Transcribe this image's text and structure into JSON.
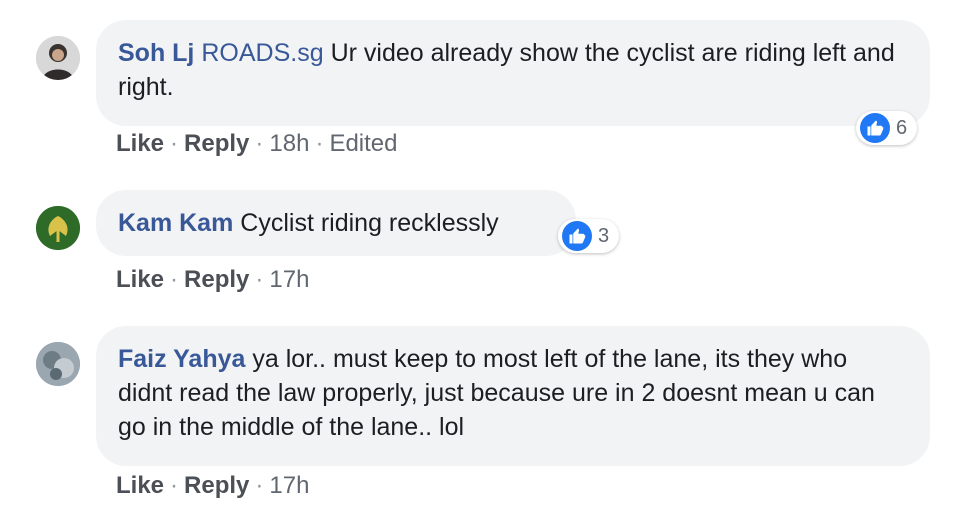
{
  "comments": [
    {
      "author": "Soh Lj",
      "mention": "ROADS.sg",
      "text": "Ur video already show the cyclist are riding left and right.",
      "actions": {
        "like": "Like",
        "reply": "Reply",
        "time": "18h",
        "edited": "Edited"
      },
      "reactions": {
        "icon": "like-icon",
        "count": "6"
      }
    },
    {
      "author": "Kam Kam",
      "text": "Cyclist riding recklessly",
      "actions": {
        "like": "Like",
        "reply": "Reply",
        "time": "17h"
      },
      "reactions": {
        "icon": "like-icon",
        "count": "3"
      }
    },
    {
      "author": "Faiz Yahya",
      "text": "ya lor.. must keep to most left of the lane, its they who didnt read the law properly, just because ure in 2 doesnt mean u can go in the middle of the lane.. lol",
      "actions": {
        "like": "Like",
        "reply": "Reply",
        "time": "17h"
      }
    }
  ],
  "colors": {
    "author": "#385898",
    "bubble": "#f2f3f5",
    "like_blue": "#2078f4"
  }
}
